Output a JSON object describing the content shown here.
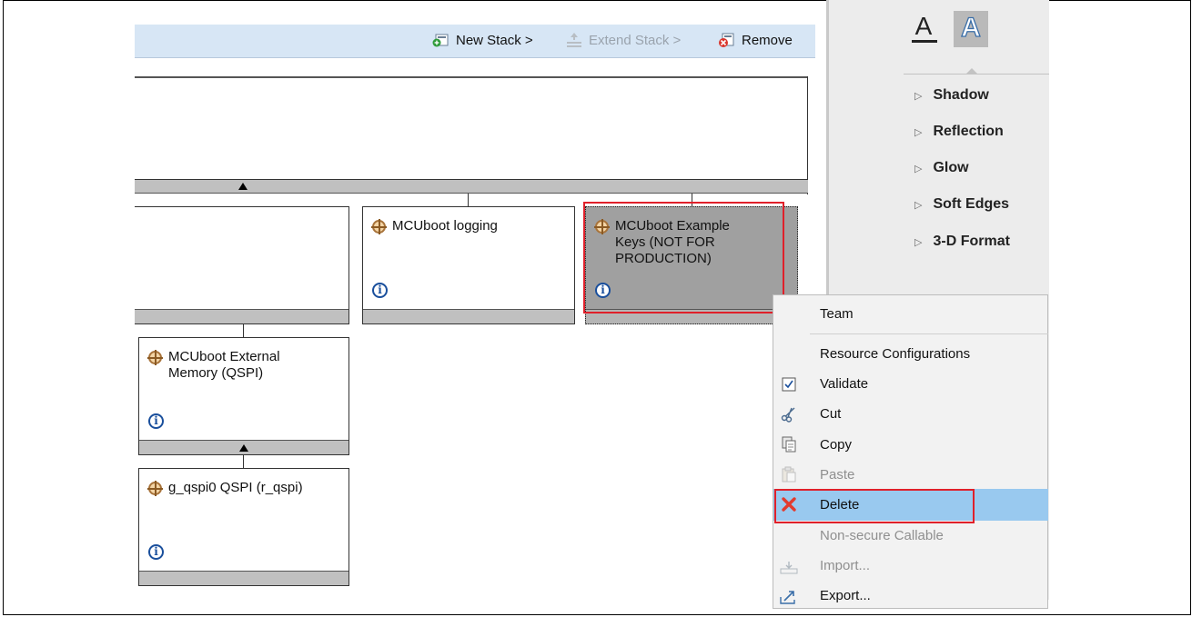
{
  "toolbar": {
    "new_stack": "New Stack >",
    "extend_stack": "Extend Stack >",
    "remove": "Remove"
  },
  "stack_nodes": {
    "logging": {
      "title": "MCUboot logging"
    },
    "example_keys": {
      "title": "MCUboot Example Keys (NOT FOR PRODUCTION)"
    },
    "external_memory": {
      "title": "MCUboot External Memory (QSPI)"
    },
    "qspi": {
      "title": "g_qspi0 QSPI (r_qspi)"
    },
    "info_glyph": "i"
  },
  "effects_panel": {
    "text_fill_glyph": "A",
    "text_outline_glyph": "A",
    "items": [
      "Shadow",
      "Reflection",
      "Glow",
      "Soft Edges",
      "3-D Format"
    ]
  },
  "context_menu": {
    "team": "Team",
    "resource_configurations": "Resource Configurations",
    "validate": "Validate",
    "cut": "Cut",
    "copy": "Copy",
    "paste": "Paste",
    "delete": "Delete",
    "non_secure_callable": "Non-secure Callable",
    "import": "Import...",
    "export": "Export..."
  },
  "colors": {
    "highlight": "#99c9ef",
    "red_outline": "#e0202a",
    "toolbar_bg": "#d7e6f5",
    "selected_node": "#a0a0a0"
  }
}
